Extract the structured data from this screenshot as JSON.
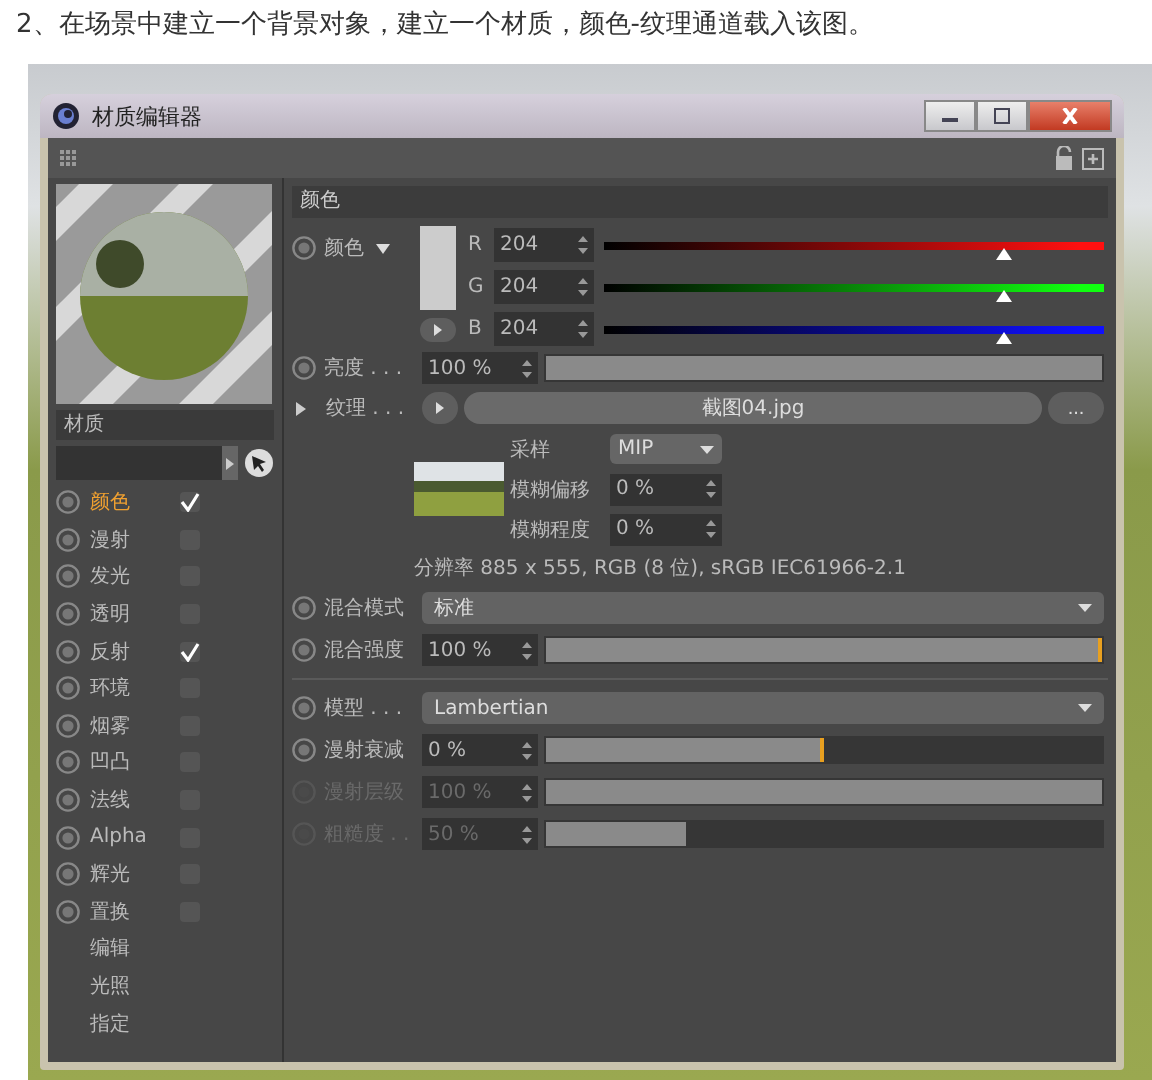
{
  "caption": "2、在场景中建立一个背景对象，建立一个材质，颜色-纹理通道载入该图。",
  "window": {
    "title": "材质编辑器"
  },
  "material_name": "材质",
  "channels": [
    {
      "label": "颜色",
      "kind": "channel",
      "checked": true,
      "selected": true
    },
    {
      "label": "漫射",
      "kind": "channel",
      "checked": false,
      "selected": false
    },
    {
      "label": "发光",
      "kind": "channel",
      "checked": false,
      "selected": false
    },
    {
      "label": "透明",
      "kind": "channel",
      "checked": false,
      "selected": false
    },
    {
      "label": "反射",
      "kind": "channel",
      "checked": true,
      "selected": false
    },
    {
      "label": "环境",
      "kind": "channel",
      "checked": false,
      "selected": false
    },
    {
      "label": "烟雾",
      "kind": "channel",
      "checked": false,
      "selected": false
    },
    {
      "label": "凹凸",
      "kind": "channel",
      "checked": false,
      "selected": false
    },
    {
      "label": "法线",
      "kind": "channel",
      "checked": false,
      "selected": false
    },
    {
      "label": "Alpha",
      "kind": "channel",
      "checked": false,
      "selected": false
    },
    {
      "label": "辉光",
      "kind": "channel",
      "checked": false,
      "selected": false
    },
    {
      "label": "置换",
      "kind": "channel",
      "checked": false,
      "selected": false
    },
    {
      "label": "编辑",
      "kind": "plain",
      "selected": false
    },
    {
      "label": "光照",
      "kind": "plain",
      "selected": false
    },
    {
      "label": "指定",
      "kind": "plain",
      "selected": false
    }
  ],
  "section_title": "颜色",
  "color": {
    "label": "颜色",
    "components": [
      {
        "label": "R",
        "value": "204",
        "level": 0.8,
        "color": "#ff1010"
      },
      {
        "label": "G",
        "value": "204",
        "level": 0.8,
        "color": "#10ff10"
      },
      {
        "label": "B",
        "value": "204",
        "level": 0.8,
        "color": "#1010ff"
      }
    ]
  },
  "brightness": {
    "label": "亮度 . . .",
    "value": "100 %",
    "level": 1
  },
  "texture": {
    "label": "纹理 . . .",
    "file": "截图04.jpg",
    "browse": "...",
    "sampling": {
      "label": "采样",
      "value": "MIP"
    },
    "fields": [
      {
        "label": "模糊偏移",
        "value": "0 %"
      },
      {
        "label": "模糊程度",
        "value": "0 %"
      }
    ],
    "resolution": "分辨率 885 x 555, RGB (8 位), sRGB IEC61966-2.1"
  },
  "mix": [
    {
      "kind": "dropdown",
      "label": "混合模式",
      "value": "标准",
      "disabled": false
    },
    {
      "kind": "slider",
      "label": "混合强度",
      "value": "100 %",
      "level": 1,
      "disabled": false
    }
  ],
  "model": [
    {
      "kind": "dropdown",
      "label": "模型 . . .",
      "value": "Lambertian",
      "disabled": false
    },
    {
      "kind": "slider",
      "label": "漫射衰减",
      "value": "0 %",
      "level": 0.5,
      "disabled": false
    },
    {
      "kind": "slider",
      "label": "漫射层级",
      "value": "100 %",
      "level": 1,
      "disabled": true
    },
    {
      "kind": "slider",
      "label": "粗糙度 . .",
      "value": "50 %",
      "level": 0.25,
      "disabled": true
    }
  ]
}
